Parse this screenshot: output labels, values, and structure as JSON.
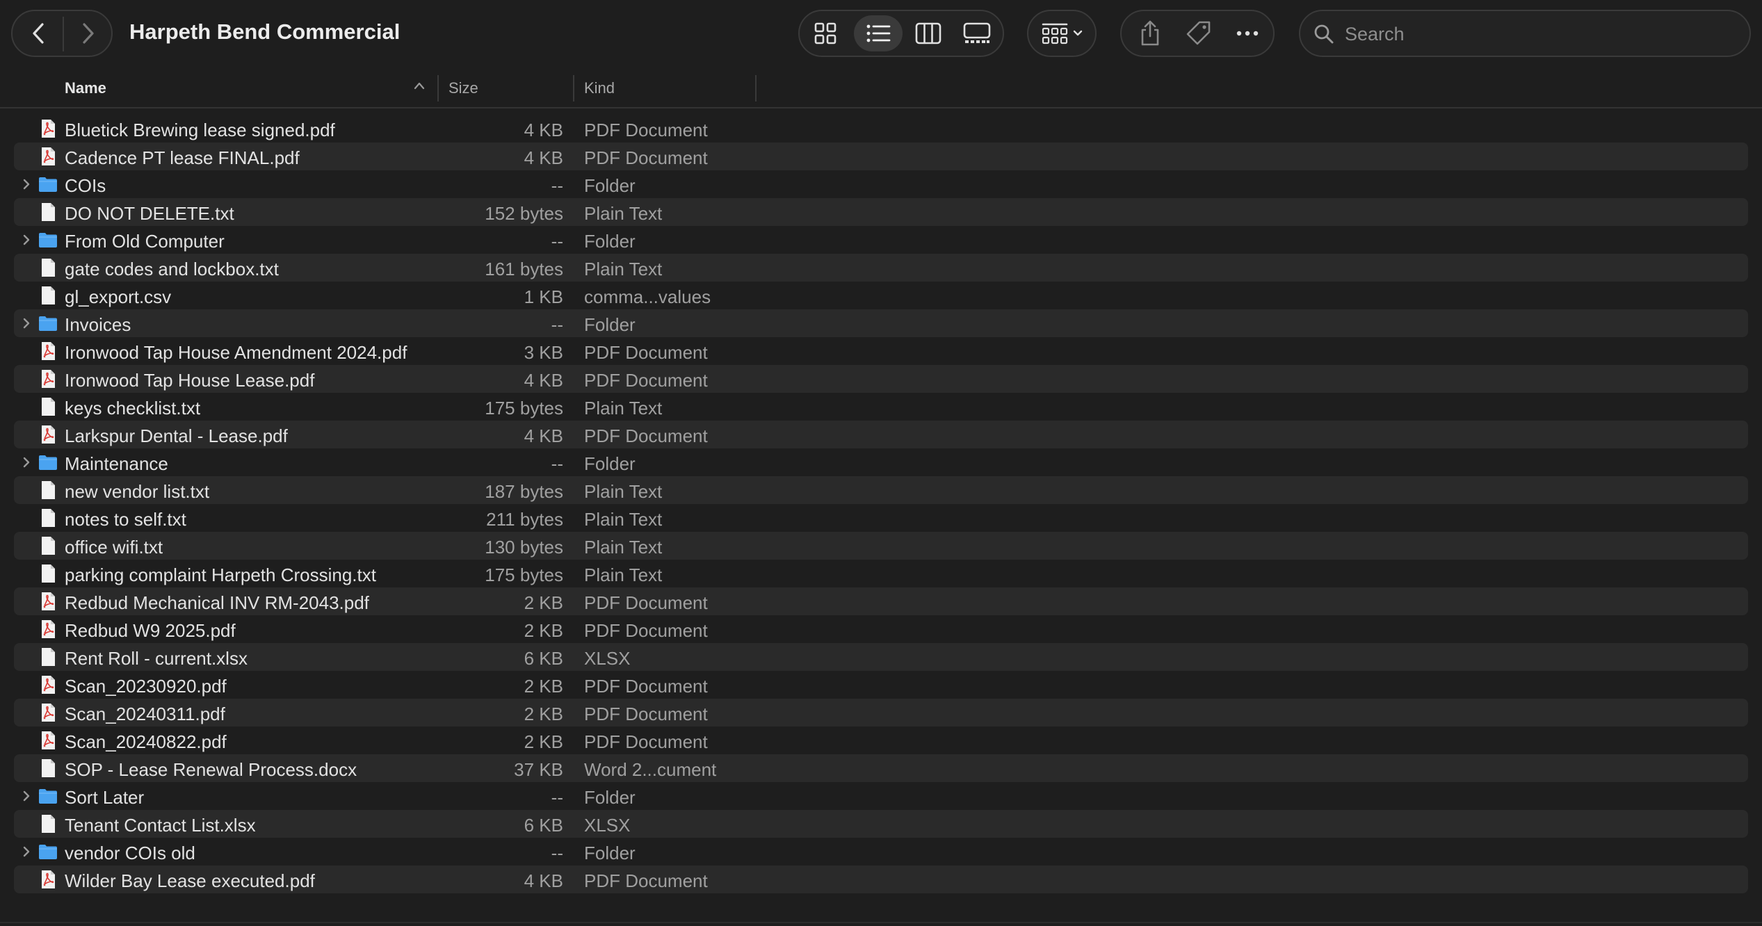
{
  "window": {
    "title": "Harpeth Bend Commercial"
  },
  "toolbar": {
    "back_icon": "chevron-left-icon",
    "forward_icon": "chevron-right-icon",
    "views": [
      "icon-view",
      "list-view",
      "column-view",
      "gallery-view"
    ],
    "active_view": "list-view",
    "group_icon": "group-by-icon",
    "actions": [
      "share-icon",
      "tag-icon",
      "more-icon"
    ],
    "search_placeholder": "Search"
  },
  "columns": {
    "name": "Name",
    "size": "Size",
    "kind": "Kind",
    "sorted_by": "name",
    "sort_direction": "ascending"
  },
  "colors": {
    "background": "#1e1e1e",
    "alt_row": "#2a2a2a",
    "folder": "#4aa3f0",
    "pdf_accent": "#d93a35"
  },
  "files": [
    {
      "name": "Bluetick Brewing lease signed.pdf",
      "size": "4 KB",
      "kind": "PDF Document",
      "icon": "pdf"
    },
    {
      "name": "Cadence PT lease FINAL.pdf",
      "size": "4 KB",
      "kind": "PDF Document",
      "icon": "pdf"
    },
    {
      "name": "COIs",
      "size": "--",
      "kind": "Folder",
      "icon": "folder"
    },
    {
      "name": "DO NOT DELETE.txt",
      "size": "152 bytes",
      "kind": "Plain Text",
      "icon": "doc"
    },
    {
      "name": "From Old Computer",
      "size": "--",
      "kind": "Folder",
      "icon": "folder"
    },
    {
      "name": "gate codes and lockbox.txt",
      "size": "161 bytes",
      "kind": "Plain Text",
      "icon": "doc"
    },
    {
      "name": "gl_export.csv",
      "size": "1 KB",
      "kind": "comma...values",
      "icon": "doc"
    },
    {
      "name": "Invoices",
      "size": "--",
      "kind": "Folder",
      "icon": "folder"
    },
    {
      "name": "Ironwood Tap House Amendment 2024.pdf",
      "size": "3 KB",
      "kind": "PDF Document",
      "icon": "pdf"
    },
    {
      "name": "Ironwood Tap House Lease.pdf",
      "size": "4 KB",
      "kind": "PDF Document",
      "icon": "pdf"
    },
    {
      "name": "keys checklist.txt",
      "size": "175 bytes",
      "kind": "Plain Text",
      "icon": "doc"
    },
    {
      "name": "Larkspur Dental - Lease.pdf",
      "size": "4 KB",
      "kind": "PDF Document",
      "icon": "pdf"
    },
    {
      "name": "Maintenance",
      "size": "--",
      "kind": "Folder",
      "icon": "folder"
    },
    {
      "name": "new vendor list.txt",
      "size": "187 bytes",
      "kind": "Plain Text",
      "icon": "doc"
    },
    {
      "name": "notes to self.txt",
      "size": "211 bytes",
      "kind": "Plain Text",
      "icon": "doc"
    },
    {
      "name": "office wifi.txt",
      "size": "130 bytes",
      "kind": "Plain Text",
      "icon": "doc"
    },
    {
      "name": "parking complaint Harpeth Crossing.txt",
      "size": "175 bytes",
      "kind": "Plain Text",
      "icon": "doc"
    },
    {
      "name": "Redbud Mechanical INV RM-2043.pdf",
      "size": "2 KB",
      "kind": "PDF Document",
      "icon": "pdf"
    },
    {
      "name": "Redbud W9 2025.pdf",
      "size": "2 KB",
      "kind": "PDF Document",
      "icon": "pdf"
    },
    {
      "name": "Rent Roll - current.xlsx",
      "size": "6 KB",
      "kind": "XLSX",
      "icon": "doc"
    },
    {
      "name": "Scan_20230920.pdf",
      "size": "2 KB",
      "kind": "PDF Document",
      "icon": "pdf"
    },
    {
      "name": "Scan_20240311.pdf",
      "size": "2 KB",
      "kind": "PDF Document",
      "icon": "pdf"
    },
    {
      "name": "Scan_20240822.pdf",
      "size": "2 KB",
      "kind": "PDF Document",
      "icon": "pdf"
    },
    {
      "name": "SOP - Lease Renewal Process.docx",
      "size": "37 KB",
      "kind": "Word 2...cument",
      "icon": "doc"
    },
    {
      "name": "Sort Later",
      "size": "--",
      "kind": "Folder",
      "icon": "folder"
    },
    {
      "name": "Tenant Contact List.xlsx",
      "size": "6 KB",
      "kind": "XLSX",
      "icon": "doc"
    },
    {
      "name": "vendor COIs old",
      "size": "--",
      "kind": "Folder",
      "icon": "folder"
    },
    {
      "name": "Wilder Bay Lease executed.pdf",
      "size": "4 KB",
      "kind": "PDF Document",
      "icon": "pdf"
    }
  ]
}
